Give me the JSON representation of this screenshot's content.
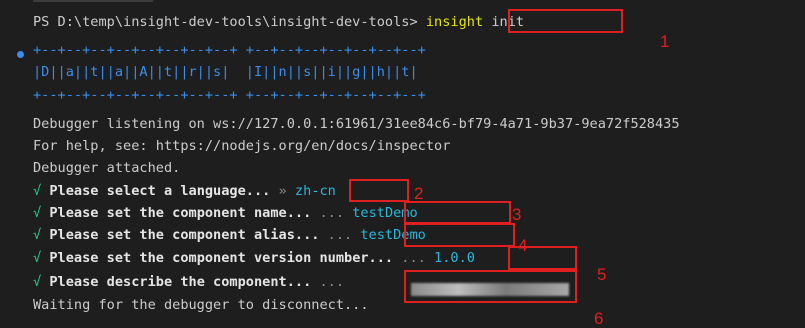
{
  "terminal": {
    "prompt": "PS D:\\temp\\insight-dev-tools\\insight-dev-tools>",
    "command_word": "insight",
    "command_arg": " init",
    "banner": [
      "+--+--+--+--+--+--+--+--+ +--+--+--+--+--+--+--+",
      "|D||a||t||a||A||t||r||s|  |I||n||s||i||g||h||t|",
      "+--+--+--+--+--+--+--+--+ +--+--+--+--+--+--+--+"
    ],
    "debugger_listening": "Debugger listening on ws://127.0.0.1:61961/31ee84c6-bf79-4a71-9b37-9ea72f528435",
    "help": "For help, see: https://nodejs.org/en/docs/inspector",
    "attached": "Debugger attached.",
    "check_mark": "√",
    "prompts": [
      {
        "question": "Please select a language...",
        "sep": " » ",
        "answer": "zh-cn"
      },
      {
        "question": "Please set the component name...",
        "sep": " ... ",
        "answer": "testDemo"
      },
      {
        "question": "Please set the component alias...",
        "sep": " ... ",
        "answer": "testDemo"
      },
      {
        "question": "Please set the component version number...",
        "sep": " ... ",
        "answer": "1.0.0"
      },
      {
        "question": "Please describe the component...",
        "sep": " ... ",
        "answer": ""
      }
    ],
    "waiting": "Waiting for the debugger to disconnect..."
  },
  "annotations": [
    "1",
    "2",
    "3",
    "4",
    "5",
    "6"
  ],
  "colors": {
    "annotation": "#e02020",
    "banner": "#3b8eea",
    "command": "#e5e510",
    "check": "#23d18b"
  }
}
